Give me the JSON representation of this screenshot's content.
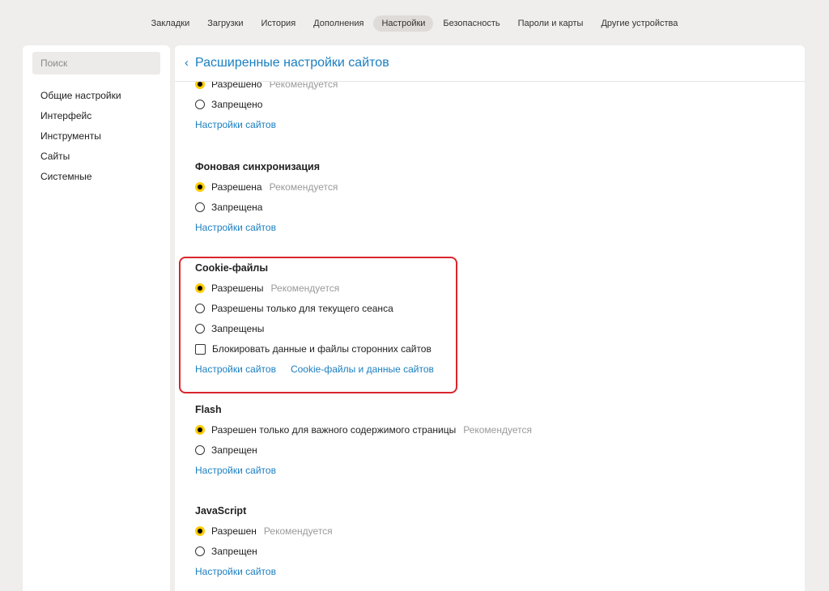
{
  "topnav": {
    "tabs": [
      {
        "label": "Закладки"
      },
      {
        "label": "Загрузки"
      },
      {
        "label": "История"
      },
      {
        "label": "Дополнения"
      },
      {
        "label": "Настройки",
        "active": true
      },
      {
        "label": "Безопасность"
      },
      {
        "label": "Пароли и карты"
      },
      {
        "label": "Другие устройства"
      }
    ]
  },
  "sidebar": {
    "search_placeholder": "Поиск",
    "items": [
      {
        "label": "Общие настройки"
      },
      {
        "label": "Интерфейс"
      },
      {
        "label": "Инструменты"
      },
      {
        "label": "Сайты"
      },
      {
        "label": "Системные"
      }
    ]
  },
  "header": {
    "back_icon": "‹",
    "title": "Расширенные настройки сайтов"
  },
  "recommended_label": "Рекомендуется",
  "colors": {
    "link": "#1a7fc1",
    "radio_selected": "#ffcc00",
    "highlight": "#d9262c"
  },
  "sections": {
    "top": {
      "options": [
        {
          "label": "Разрешено",
          "selected": true,
          "recommended": "Рекомендуется"
        },
        {
          "label": "Запрещено",
          "selected": false
        }
      ],
      "links": [
        "Настройки сайтов"
      ]
    },
    "background_sync": {
      "title": "Фоновая синхронизация",
      "options": [
        {
          "label": "Разрешена",
          "selected": true,
          "recommended": "Рекомендуется"
        },
        {
          "label": "Запрещена",
          "selected": false
        }
      ],
      "links": [
        "Настройки сайтов"
      ]
    },
    "cookies": {
      "title": "Cookie-файлы",
      "options": [
        {
          "label": "Разрешены",
          "selected": true,
          "recommended": "Рекомендуется"
        },
        {
          "label": "Разрешены только для текущего сеанса",
          "selected": false
        },
        {
          "label": "Запрещены",
          "selected": false
        }
      ],
      "checkbox": {
        "label": "Блокировать данные и файлы сторонних сайтов",
        "checked": false
      },
      "links": [
        "Настройки сайтов",
        "Cookie-файлы и данные сайтов"
      ]
    },
    "flash": {
      "title": "Flash",
      "options": [
        {
          "label": "Разрешен только для важного содержимого страницы",
          "selected": true,
          "recommended": "Рекомендуется"
        },
        {
          "label": "Запрещен",
          "selected": false
        }
      ],
      "links": [
        "Настройки сайтов"
      ]
    },
    "javascript": {
      "title": "JavaScript",
      "options": [
        {
          "label": "Разрешен",
          "selected": true,
          "recommended": "Рекомендуется"
        },
        {
          "label": "Запрещен",
          "selected": false
        }
      ],
      "links": [
        "Настройки сайтов"
      ]
    }
  }
}
